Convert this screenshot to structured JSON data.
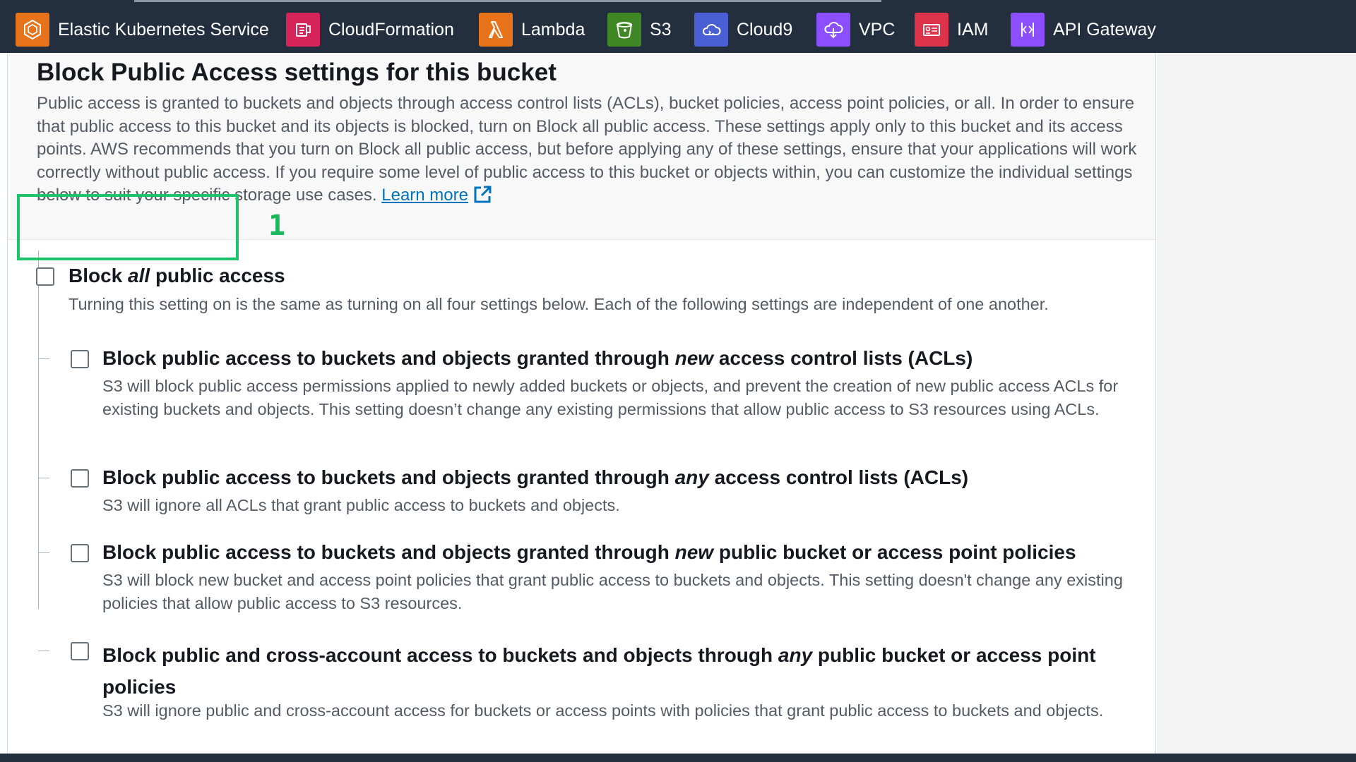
{
  "nav": {
    "services": [
      {
        "label": "Elastic Kubernetes Service",
        "icon": "eks-icon",
        "color": "#e7731b"
      },
      {
        "label": "CloudFormation",
        "icon": "cloudformation-icon",
        "color": "#d6245a"
      },
      {
        "label": "Lambda",
        "icon": "lambda-icon",
        "color": "#e7731b"
      },
      {
        "label": "S3",
        "icon": "s3-icon",
        "color": "#3f8624"
      },
      {
        "label": "Cloud9",
        "icon": "cloud9-icon",
        "color": "#4a5fd3"
      },
      {
        "label": "VPC",
        "icon": "vpc-icon",
        "color": "#8c4fff"
      },
      {
        "label": "IAM",
        "icon": "iam-icon",
        "color": "#dd344c"
      },
      {
        "label": "API Gateway",
        "icon": "api-gateway-icon",
        "color": "#8c4fff"
      }
    ]
  },
  "section": {
    "title": "Block Public Access settings for this bucket",
    "description": "Public access is granted to buckets and objects through access control lists (ACLs), bucket policies, access point policies, or all. In order to ensure that public access to this bucket and its objects is blocked, turn on Block all public access. These settings apply only to this bucket and its access points. AWS recommends that you turn on Block all public access, but before applying any of these settings, ensure that your applications will work correctly without public access. If you require some level of public access to this bucket or objects within, you can customize the individual settings below to suit your specific storage use cases.",
    "learn_more": "Learn more"
  },
  "block_all": {
    "label_pre": "Block ",
    "label_em": "all",
    "label_post": " public access",
    "description": "Turning this setting on is the same as turning on all four settings below. Each of the following settings are independent of one another.",
    "checked": false
  },
  "options": [
    {
      "label_pre": "Block public access to buckets and objects granted through ",
      "label_em": "new",
      "label_post": " access control lists (ACLs)",
      "description": "S3 will block public access permissions applied to newly added buckets or objects, and prevent the creation of new public access ACLs for existing buckets and objects. This setting doesn’t change any existing permissions that allow public access to S3 resources using ACLs.",
      "checked": false
    },
    {
      "label_pre": "Block public access to buckets and objects granted through ",
      "label_em": "any",
      "label_post": " access control lists (ACLs)",
      "description": "S3 will ignore all ACLs that grant public access to buckets and objects.",
      "checked": false
    },
    {
      "label_pre": "Block public access to buckets and objects granted through ",
      "label_em": "new",
      "label_post": " public bucket or access point policies",
      "description": "S3 will block new bucket and access point policies that grant public access to buckets and objects. This setting doesn't change any existing policies that allow public access to S3 resources.",
      "checked": false
    },
    {
      "label_pre": "Block public and cross-account access to buckets and objects through ",
      "label_em": "any",
      "label_post": " public bucket or access point policies",
      "description": "S3 will ignore public and cross-account access for buckets or access points with policies that grant public access to buckets and objects.",
      "checked": false
    }
  ],
  "annotation": {
    "step_number": "1",
    "color": "#1dc46a"
  }
}
